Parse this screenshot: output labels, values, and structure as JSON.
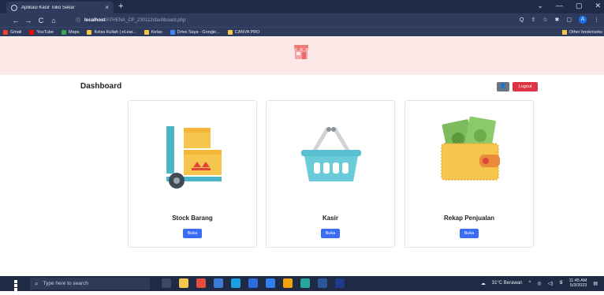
{
  "browser": {
    "tab_title": "Aplikasi Kasir Toko Sekar",
    "tab_close": "×",
    "new_tab": "+",
    "window_controls": [
      "⌄",
      "—",
      "▢",
      "✕"
    ],
    "nav": [
      "←",
      "→",
      "C",
      "⌂"
    ],
    "url_host": "localhost",
    "url_path": "/ATHENA_CP_230112/dashboard.php",
    "right_icons": [
      "Q",
      "⇪",
      "☆",
      "✱",
      "▢"
    ],
    "profile_initial": "A",
    "menu": "⋮",
    "bookmarks": [
      {
        "label": "Gmail",
        "color": "#ea4335"
      },
      {
        "label": "YouTube",
        "color": "#ff0000"
      },
      {
        "label": "Maps",
        "color": "#34a853"
      },
      {
        "label": "Kelas Kuliah | eLear...",
        "color": "#f6c648"
      },
      {
        "label": "Kelas",
        "color": "#f6c648"
      },
      {
        "label": "Drive Saya - Google...",
        "color": "#4285f4"
      },
      {
        "label": "CANVA PRO",
        "color": "#f6c648"
      }
    ],
    "other_bookmarks": "Other bookmarks"
  },
  "page": {
    "title": "Dashboard",
    "user_button": "👤",
    "logout_button": "Logout",
    "header_bg": "#fde8e8"
  },
  "cards": [
    {
      "name": "Stock Barang",
      "button": "Buka",
      "icon": "hand-truck-boxes-icon"
    },
    {
      "name": "Kasir",
      "button": "Buka",
      "icon": "shopping-basket-icon"
    },
    {
      "name": "Rekap Penjualan",
      "button": "Buka",
      "icon": "wallet-money-icon"
    }
  ],
  "taskbar": {
    "search_placeholder": "Type here to search",
    "weather": "31°C Berawan",
    "time": "11:45 AM",
    "date": "5/3/2023"
  },
  "colors": {
    "accent_blue": "#3b6cf6",
    "logout_red": "#dc3545"
  }
}
